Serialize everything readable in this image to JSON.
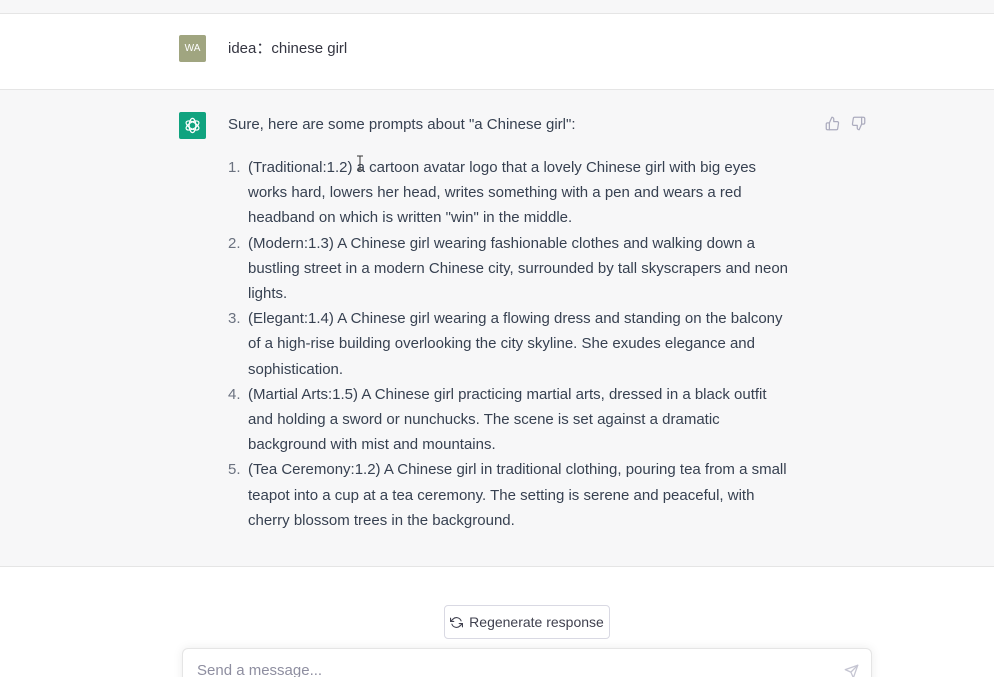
{
  "user_message": {
    "avatar_initials": "WA",
    "avatar_color": "#a0a580",
    "text": "idea：chinese girl"
  },
  "assistant_message": {
    "avatar_icon": "openai-logo-icon",
    "avatar_color": "#10a37f",
    "intro": "Sure, here are some prompts about \"a Chinese girl\":",
    "prompts": [
      {
        "number": "1.",
        "lines": [
          "(Traditional:1.2) a cartoon avatar logo that a lovely Chinese girl with big eyes",
          "works hard, lowers her head, writes something with a pen and wears a red",
          "headband on which is written \"win\" in the middle."
        ]
      },
      {
        "number": "2.",
        "lines": [
          "(Modern:1.3) A Chinese girl wearing fashionable clothes and walking down a",
          "bustling street in a modern Chinese city, surrounded by tall skyscrapers and neon",
          "lights."
        ]
      },
      {
        "number": "3.",
        "lines": [
          "(Elegant:1.4) A Chinese girl wearing a flowing dress and standing on the balcony",
          "of a high-rise building overlooking the city skyline. She exudes elegance and",
          "sophistication."
        ]
      },
      {
        "number": "4.",
        "lines": [
          "(Martial Arts:1.5) A Chinese girl practicing martial arts, dressed in a black outfit",
          "and holding a sword or nunchucks. The scene is set against a dramatic",
          "background with mist and mountains."
        ]
      },
      {
        "number": "5.",
        "lines": [
          "(Tea Ceremony:1.2) A Chinese girl in traditional clothing, pouring tea from a small",
          "teapot into a cup at a tea ceremony. The setting is serene and peaceful, with",
          "cherry blossom trees in the background."
        ]
      }
    ],
    "feedback_icons": [
      "thumbs-up-icon",
      "thumbs-down-icon"
    ]
  },
  "controls": {
    "regenerate_label": "Regenerate response",
    "regenerate_icon": "refresh-icon",
    "composer_placeholder": "Send a message...",
    "send_icon": "paper-plane-icon"
  }
}
